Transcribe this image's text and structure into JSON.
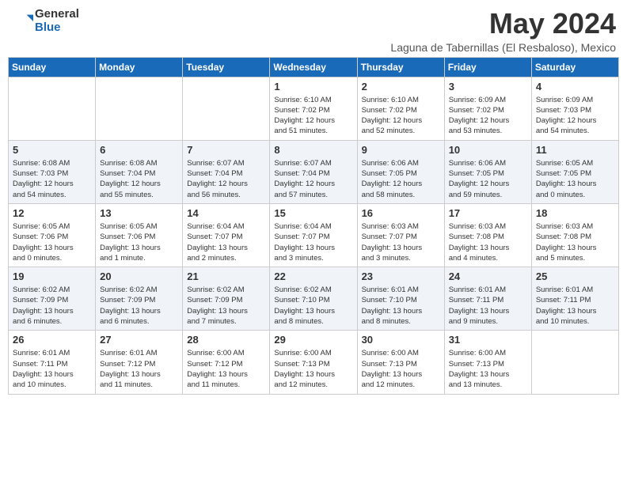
{
  "logo": {
    "general": "General",
    "blue": "Blue"
  },
  "title": "May 2024",
  "location": "Laguna de Tabernillas (El Resbaloso), Mexico",
  "days_of_week": [
    "Sunday",
    "Monday",
    "Tuesday",
    "Wednesday",
    "Thursday",
    "Friday",
    "Saturday"
  ],
  "weeks": [
    [
      {
        "day": "",
        "info": ""
      },
      {
        "day": "",
        "info": ""
      },
      {
        "day": "",
        "info": ""
      },
      {
        "day": "1",
        "info": "Sunrise: 6:10 AM\nSunset: 7:02 PM\nDaylight: 12 hours\nand 51 minutes."
      },
      {
        "day": "2",
        "info": "Sunrise: 6:10 AM\nSunset: 7:02 PM\nDaylight: 12 hours\nand 52 minutes."
      },
      {
        "day": "3",
        "info": "Sunrise: 6:09 AM\nSunset: 7:02 PM\nDaylight: 12 hours\nand 53 minutes."
      },
      {
        "day": "4",
        "info": "Sunrise: 6:09 AM\nSunset: 7:03 PM\nDaylight: 12 hours\nand 54 minutes."
      }
    ],
    [
      {
        "day": "5",
        "info": "Sunrise: 6:08 AM\nSunset: 7:03 PM\nDaylight: 12 hours\nand 54 minutes."
      },
      {
        "day": "6",
        "info": "Sunrise: 6:08 AM\nSunset: 7:04 PM\nDaylight: 12 hours\nand 55 minutes."
      },
      {
        "day": "7",
        "info": "Sunrise: 6:07 AM\nSunset: 7:04 PM\nDaylight: 12 hours\nand 56 minutes."
      },
      {
        "day": "8",
        "info": "Sunrise: 6:07 AM\nSunset: 7:04 PM\nDaylight: 12 hours\nand 57 minutes."
      },
      {
        "day": "9",
        "info": "Sunrise: 6:06 AM\nSunset: 7:05 PM\nDaylight: 12 hours\nand 58 minutes."
      },
      {
        "day": "10",
        "info": "Sunrise: 6:06 AM\nSunset: 7:05 PM\nDaylight: 12 hours\nand 59 minutes."
      },
      {
        "day": "11",
        "info": "Sunrise: 6:05 AM\nSunset: 7:05 PM\nDaylight: 13 hours\nand 0 minutes."
      }
    ],
    [
      {
        "day": "12",
        "info": "Sunrise: 6:05 AM\nSunset: 7:06 PM\nDaylight: 13 hours\nand 0 minutes."
      },
      {
        "day": "13",
        "info": "Sunrise: 6:05 AM\nSunset: 7:06 PM\nDaylight: 13 hours\nand 1 minute."
      },
      {
        "day": "14",
        "info": "Sunrise: 6:04 AM\nSunset: 7:07 PM\nDaylight: 13 hours\nand 2 minutes."
      },
      {
        "day": "15",
        "info": "Sunrise: 6:04 AM\nSunset: 7:07 PM\nDaylight: 13 hours\nand 3 minutes."
      },
      {
        "day": "16",
        "info": "Sunrise: 6:03 AM\nSunset: 7:07 PM\nDaylight: 13 hours\nand 3 minutes."
      },
      {
        "day": "17",
        "info": "Sunrise: 6:03 AM\nSunset: 7:08 PM\nDaylight: 13 hours\nand 4 minutes."
      },
      {
        "day": "18",
        "info": "Sunrise: 6:03 AM\nSunset: 7:08 PM\nDaylight: 13 hours\nand 5 minutes."
      }
    ],
    [
      {
        "day": "19",
        "info": "Sunrise: 6:02 AM\nSunset: 7:09 PM\nDaylight: 13 hours\nand 6 minutes."
      },
      {
        "day": "20",
        "info": "Sunrise: 6:02 AM\nSunset: 7:09 PM\nDaylight: 13 hours\nand 6 minutes."
      },
      {
        "day": "21",
        "info": "Sunrise: 6:02 AM\nSunset: 7:09 PM\nDaylight: 13 hours\nand 7 minutes."
      },
      {
        "day": "22",
        "info": "Sunrise: 6:02 AM\nSunset: 7:10 PM\nDaylight: 13 hours\nand 8 minutes."
      },
      {
        "day": "23",
        "info": "Sunrise: 6:01 AM\nSunset: 7:10 PM\nDaylight: 13 hours\nand 8 minutes."
      },
      {
        "day": "24",
        "info": "Sunrise: 6:01 AM\nSunset: 7:11 PM\nDaylight: 13 hours\nand 9 minutes."
      },
      {
        "day": "25",
        "info": "Sunrise: 6:01 AM\nSunset: 7:11 PM\nDaylight: 13 hours\nand 10 minutes."
      }
    ],
    [
      {
        "day": "26",
        "info": "Sunrise: 6:01 AM\nSunset: 7:11 PM\nDaylight: 13 hours\nand 10 minutes."
      },
      {
        "day": "27",
        "info": "Sunrise: 6:01 AM\nSunset: 7:12 PM\nDaylight: 13 hours\nand 11 minutes."
      },
      {
        "day": "28",
        "info": "Sunrise: 6:00 AM\nSunset: 7:12 PM\nDaylight: 13 hours\nand 11 minutes."
      },
      {
        "day": "29",
        "info": "Sunrise: 6:00 AM\nSunset: 7:13 PM\nDaylight: 13 hours\nand 12 minutes."
      },
      {
        "day": "30",
        "info": "Sunrise: 6:00 AM\nSunset: 7:13 PM\nDaylight: 13 hours\nand 12 minutes."
      },
      {
        "day": "31",
        "info": "Sunrise: 6:00 AM\nSunset: 7:13 PM\nDaylight: 13 hours\nand 13 minutes."
      },
      {
        "day": "",
        "info": ""
      }
    ]
  ]
}
